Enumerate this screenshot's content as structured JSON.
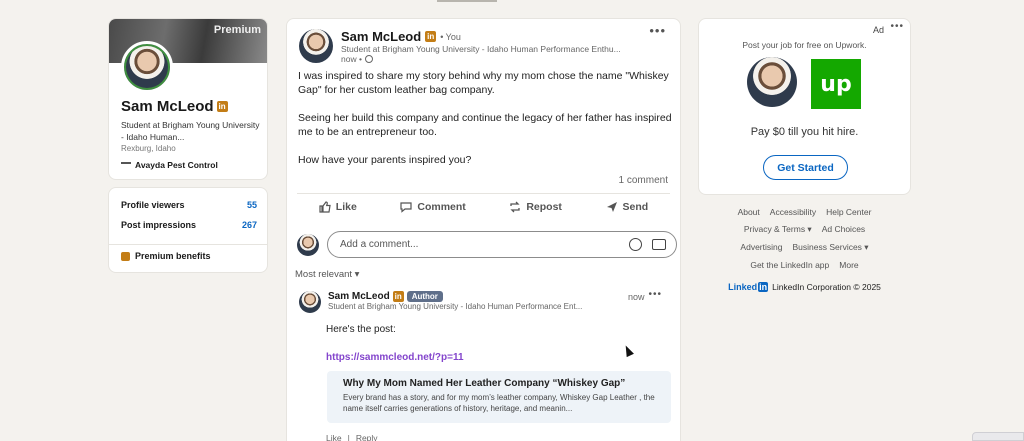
{
  "profile": {
    "premium_label": "Premium",
    "name": "Sam McLeod",
    "headline": "Student at Brigham Young University - Idaho Human...",
    "location": "Rexburg, Idaho",
    "company": "Avayda Pest Control"
  },
  "stats": {
    "viewers_label": "Profile viewers",
    "viewers_value": "55",
    "impressions_label": "Post impressions",
    "impressions_value": "267",
    "premium_benefits": "Premium benefits"
  },
  "post": {
    "author": "Sam McLeod",
    "you_label": "• You",
    "subtitle": "Student at Brigham Young University - Idaho Human Performance Enthu...",
    "time": "now •",
    "paragraphs": [
      "I was inspired to share my story behind why my mom chose the name \"Whiskey Gap\" for her custom leather bag company.",
      "Seeing her build this company and continue the legacy of her father has inspired me to be an entrepreneur too.",
      "How have your parents inspired you?"
    ],
    "comment_count": "1 comment",
    "actions": {
      "like": "Like",
      "comment": "Comment",
      "repost": "Repost",
      "send": "Send"
    },
    "comment_placeholder": "Add a comment...",
    "sort_label": "Most relevant ▾"
  },
  "comment": {
    "author": "Sam McLeod",
    "badge": "Author",
    "subtitle": "Student at Brigham Young University - Idaho Human Performance Ent...",
    "time": "now",
    "text": "Here's the post:",
    "link": "https://sammcleod.net/?p=11",
    "preview_title": "Why My Mom Named Her Leather Company “Whiskey Gap”",
    "preview_desc": "Every brand has a story, and for my mom’s leather company, Whiskey Gap Leather , the name itself carries generations of history, heritage, and meanin...",
    "like": "Like",
    "reply": "Reply"
  },
  "ad": {
    "label": "Ad",
    "text": "Post your job for free on Upwork.",
    "logo_text": "up",
    "offer": "Pay $0 till you hit hire.",
    "button": "Get Started"
  },
  "footer": {
    "about": "About",
    "accessibility": "Accessibility",
    "help": "Help Center",
    "privacy": "Privacy & Terms ▾",
    "adchoices": "Ad Choices",
    "advertising": "Advertising",
    "business": "Business Services ▾",
    "app": "Get the LinkedIn app",
    "more": "More",
    "logo_word": "Linked",
    "logo_in": "in",
    "copyright": "LinkedIn Corporation © 2025"
  },
  "colors": {
    "brand": "#0a66c2",
    "upwork": "#14a800",
    "premium_gold": "#c37d16"
  }
}
